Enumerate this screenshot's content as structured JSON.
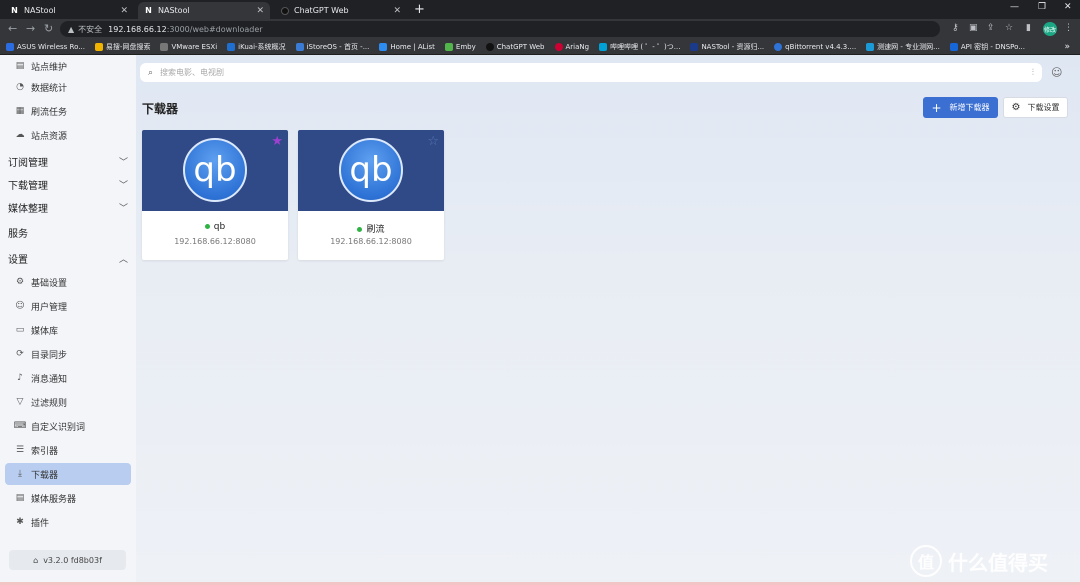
{
  "browser": {
    "tabs": [
      {
        "title": "NAStool",
        "active": false
      },
      {
        "title": "NAStool",
        "active": true
      },
      {
        "title": "ChatGPT Web",
        "active": false
      }
    ],
    "new_tab": "+",
    "address": {
      "insecure_label": "不安全",
      "host": "192.168.66.12",
      "path": ":3000/web#downloader"
    },
    "profile_label": "修改",
    "bookmarks": [
      {
        "label": "ASUS Wireless Ro...",
        "color": "#2b6de0"
      },
      {
        "label": "易搜-网盘搜索",
        "color": "#f0b400"
      },
      {
        "label": "VMware ESXi",
        "color": "#777777"
      },
      {
        "label": "iKuai-系统概况",
        "color": "#1f6fd1"
      },
      {
        "label": "iStoreOS - 首页 -...",
        "color": "#3a7bd5"
      },
      {
        "label": "Home | AList",
        "color": "#2d8cf0"
      },
      {
        "label": "Emby",
        "color": "#52b54b"
      },
      {
        "label": "ChatGPT Web",
        "color": "#111111"
      },
      {
        "label": "AriaNg",
        "color": "#c03"
      },
      {
        "label": "哔哩哔哩 ( ゜- ゜)つ...",
        "color": "#00a1d6"
      },
      {
        "label": "NASTool - 资源归...",
        "color": "#1b3a8a"
      },
      {
        "label": "qBittorrent v4.4.3....",
        "color": "#2e73d6"
      },
      {
        "label": "测速网 - 专业测网...",
        "color": "#1a9bd7"
      },
      {
        "label": "API 密钥 - DNSPo...",
        "color": "#1766d8"
      }
    ],
    "bookmarks_more": "»"
  },
  "sidebar": {
    "items_top": [
      {
        "label": "站点维护",
        "icon": "site-maintain-icon",
        "glyph": "▤"
      },
      {
        "label": "数据统计",
        "icon": "stats-icon",
        "glyph": "◔"
      },
      {
        "label": "刷流任务",
        "icon": "brush-task-icon",
        "glyph": "▦"
      },
      {
        "label": "站点资源",
        "icon": "site-resource-icon",
        "glyph": "☁"
      }
    ],
    "groups": [
      {
        "label": "订阅管理",
        "chevron": "﹀"
      },
      {
        "label": "下载管理",
        "chevron": "﹀"
      },
      {
        "label": "媒体整理",
        "chevron": "﹀"
      },
      {
        "label": "服务",
        "chevron": ""
      },
      {
        "label": "设置",
        "chevron": "︿"
      }
    ],
    "settings_items": [
      {
        "label": "基础设置",
        "icon": "basic-settings-icon",
        "glyph": "⚙"
      },
      {
        "label": "用户管理",
        "icon": "user-manage-icon",
        "glyph": "☺"
      },
      {
        "label": "媒体库",
        "icon": "media-library-icon",
        "glyph": "▭"
      },
      {
        "label": "目录同步",
        "icon": "dir-sync-icon",
        "glyph": "⟳"
      },
      {
        "label": "消息通知",
        "icon": "notification-icon",
        "glyph": "♪"
      },
      {
        "label": "过滤规则",
        "icon": "filter-rule-icon",
        "glyph": "▽"
      },
      {
        "label": "自定义识别词",
        "icon": "custom-words-icon",
        "glyph": "⌨"
      },
      {
        "label": "索引器",
        "icon": "indexer-icon",
        "glyph": "☰"
      },
      {
        "label": "下载器",
        "icon": "downloader-icon",
        "glyph": "⤓",
        "active": true
      },
      {
        "label": "媒体服务器",
        "icon": "media-server-icon",
        "glyph": "▤"
      },
      {
        "label": "插件",
        "icon": "plugin-icon",
        "glyph": "✱"
      }
    ],
    "version": "v3.2.0 fd8b03f"
  },
  "main": {
    "search_placeholder": "搜索电影、电视剧",
    "page_title": "下载器",
    "new_downloader_label": "新增下载器",
    "download_settings_label": "下载设置",
    "cards": [
      {
        "logo_text": "qb",
        "name": "qb",
        "host": "192.168.66.12:8080",
        "starred": true,
        "status_color": "#2fb344"
      },
      {
        "logo_text": "qb",
        "name": "刷流",
        "host": "192.168.66.12:8080",
        "starred": false,
        "status_color": "#2fb344"
      }
    ]
  },
  "watermark": {
    "text": "什么值得买",
    "glyph": "值"
  },
  "colors": {
    "accent": "#3b6fd1",
    "card_header": "#2f4a87",
    "star_active": "#a040d0",
    "star_inactive": "#5a74b8"
  }
}
